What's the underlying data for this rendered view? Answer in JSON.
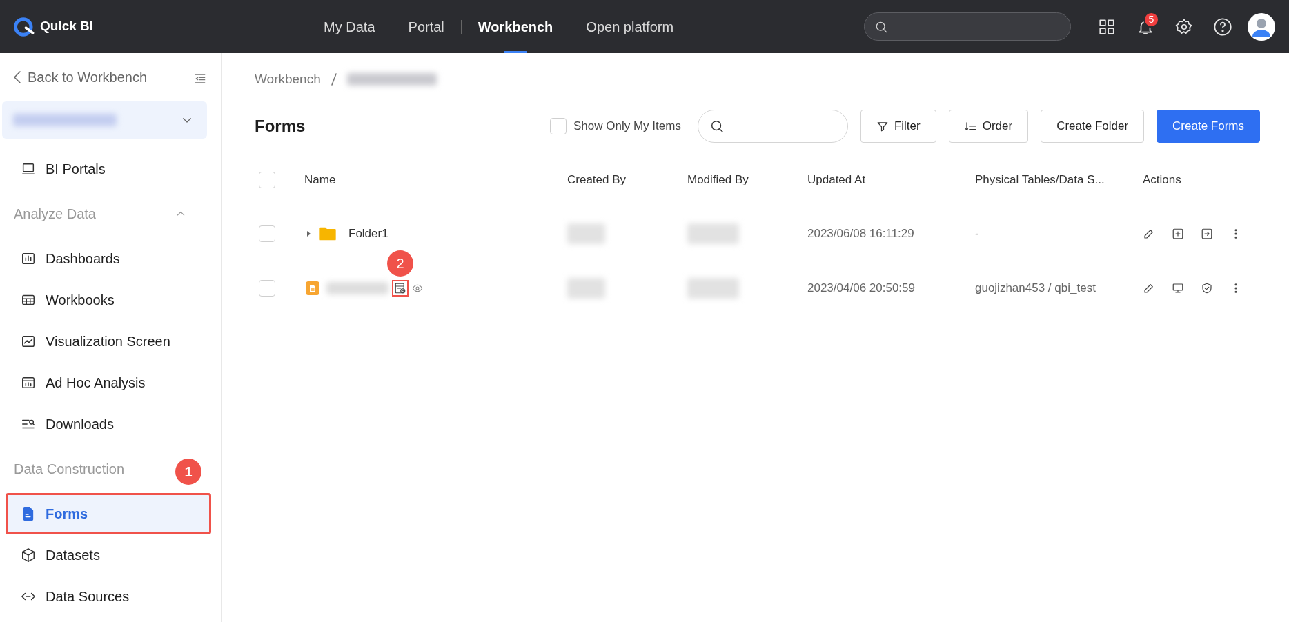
{
  "header": {
    "brand": "Quick BI",
    "nav": [
      {
        "label": "My Data",
        "selected": false
      },
      {
        "label": "Portal",
        "selected": false
      },
      {
        "label": "Workbench",
        "selected": true
      },
      {
        "label": "Open platform",
        "selected": false
      }
    ],
    "notification_count": "5"
  },
  "sidebar": {
    "back_label": "Back to Workbench",
    "items": [
      {
        "kind": "item",
        "label": "BI Portals",
        "selected": false
      },
      {
        "kind": "heading",
        "label": "Analyze Data",
        "expanded": true
      },
      {
        "kind": "item",
        "label": "Dashboards",
        "selected": false
      },
      {
        "kind": "item",
        "label": "Workbooks",
        "selected": false
      },
      {
        "kind": "item",
        "label": "Visualization Screen",
        "selected": false
      },
      {
        "kind": "item",
        "label": "Ad Hoc Analysis",
        "selected": false
      },
      {
        "kind": "item",
        "label": "Downloads",
        "selected": false
      },
      {
        "kind": "heading",
        "label": "Data Construction"
      },
      {
        "kind": "item",
        "label": "Forms",
        "selected": true,
        "callout": "1"
      },
      {
        "kind": "item",
        "label": "Datasets",
        "selected": false
      },
      {
        "kind": "item",
        "label": "Data Sources",
        "selected": false
      }
    ]
  },
  "breadcrumb": [
    "Workbench"
  ],
  "page": {
    "title": "Forms",
    "show_only_mine": {
      "label": "Show Only My Items",
      "checked": false
    },
    "buttons": [
      {
        "label": "Filter",
        "kind": "filter"
      },
      {
        "label": "Order",
        "kind": "order"
      },
      {
        "label": "Create Folder",
        "kind": "plain"
      },
      {
        "label": "Create Forms",
        "kind": "primary"
      }
    ]
  },
  "table": {
    "all_checked": false,
    "columns": [
      "Name",
      "Created By",
      "Modified By",
      "Updated At",
      "Physical Tables/Data S...",
      "Actions"
    ],
    "rows": [
      {
        "kind": "folder",
        "checked": false,
        "expanded": false,
        "name": "Folder1",
        "updated_at": "2023/06/08 16:11:29",
        "tables": "-"
      },
      {
        "kind": "form",
        "checked": false,
        "updated_at": "2023/04/06 20:50:59",
        "tables": "guojizhan453 / qbi_test",
        "callout": "2"
      }
    ]
  }
}
